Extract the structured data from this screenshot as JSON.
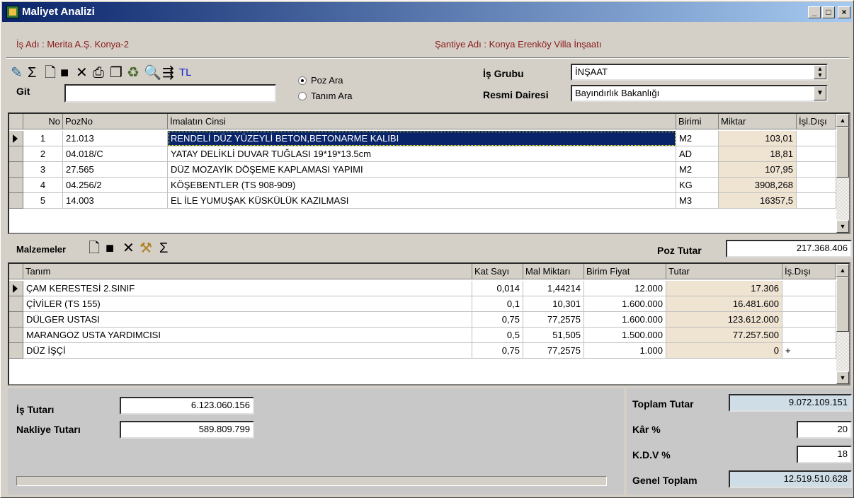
{
  "window": {
    "title": "Maliyet Analizi"
  },
  "info": {
    "is_adi": "İş Adı : Merita A.Ş. Konya-2",
    "santiye_adi": "Şantiye  Adı : Konya Erenköy Villa İnşaatı"
  },
  "toolbar": {
    "tl_label": "TL",
    "git_label": "Git",
    "git_value": ""
  },
  "search": {
    "poz_ara": "Poz Ara",
    "tanim_ara": "Tanım Ara",
    "selected": "Poz Ara"
  },
  "filters": {
    "is_grubu_label": "İş Grubu",
    "is_grubu_value": "İNŞAAT",
    "resmi_dairesi_label": "Resmi Dairesi",
    "resmi_dairesi_value": "Bayındırlık Bakanlığı"
  },
  "poz_table": {
    "headers": {
      "no": "No",
      "pozno": "PozNo",
      "imalat": "İmalatın Cinsi",
      "birimi": "Birimi",
      "miktar": "Miktar",
      "isl_disi": "İşl.Dışı"
    },
    "rows": [
      {
        "no": "1",
        "pozno": "21.013",
        "imalat": "RENDELİ DÜZ YÜZEYLİ BETON,BETONARME KALIBI",
        "birimi": "M2",
        "miktar": "103,01",
        "isl_disi": ""
      },
      {
        "no": "2",
        "pozno": "04.018/C",
        "imalat": "YATAY DELİKLİ DUVAR TUĞLASI 19*19*13.5cm",
        "birimi": "AD",
        "miktar": "18,81",
        "isl_disi": ""
      },
      {
        "no": "3",
        "pozno": "27.565",
        "imalat": "DÜZ MOZAYİK DÖŞEME KAPLAMASI YAPIMI",
        "birimi": "M2",
        "miktar": "107,95",
        "isl_disi": ""
      },
      {
        "no": "4",
        "pozno": "04.256/2",
        "imalat": "KÖŞEBENTLER (TS 908-909)",
        "birimi": "KG",
        "miktar": "3908,268",
        "isl_disi": ""
      },
      {
        "no": "5",
        "pozno": "14.003",
        "imalat": "EL İLE YUMUŞAK KÜSKÜLÜK KAZILMASI",
        "birimi": "M3",
        "miktar": "16357,5",
        "isl_disi": ""
      }
    ]
  },
  "malzemeler": {
    "label": "Malzemeler",
    "poz_tutar_label": "Poz Tutar",
    "poz_tutar_value": "217.368.406"
  },
  "mat_table": {
    "headers": {
      "tanim": "Tanım",
      "kat_sayi": "Kat Sayı",
      "mal_miktari": "Mal Miktarı",
      "birim_fiyat": "Birim Fiyat",
      "tutar": "Tutar",
      "is_disi": "İş.Dışı"
    },
    "rows": [
      {
        "tanim": "ÇAM KERESTESİ 2.SINIF",
        "kat_sayi": "0,014",
        "mal_miktari": "1,44214",
        "birim_fiyat": "12.000",
        "tutar": "17.306",
        "is_disi": ""
      },
      {
        "tanim": "ÇİVİLER (TS 155)",
        "kat_sayi": "0,1",
        "mal_miktari": "10,301",
        "birim_fiyat": "1.600.000",
        "tutar": "16.481.600",
        "is_disi": ""
      },
      {
        "tanim": "DÜLGER USTASI",
        "kat_sayi": "0,75",
        "mal_miktari": "77,2575",
        "birim_fiyat": "1.600.000",
        "tutar": "123.612.000",
        "is_disi": ""
      },
      {
        "tanim": "MARANGOZ USTA YARDIMCISI",
        "kat_sayi": "0,5",
        "mal_miktari": "51,505",
        "birim_fiyat": "1.500.000",
        "tutar": "77.257.500",
        "is_disi": ""
      },
      {
        "tanim": "DÜZ İŞÇİ",
        "kat_sayi": "0,75",
        "mal_miktari": "77,2575",
        "birim_fiyat": "1.000",
        "tutar": "0",
        "is_disi": "+"
      }
    ]
  },
  "totals": {
    "is_tutari_label": "İş Tutarı",
    "is_tutari_value": "6.123.060.156",
    "nakliye_label": "Nakliye Tutarı",
    "nakliye_value": "589.809.799",
    "toplam_label": "Toplam Tutar",
    "toplam_value": "9.072.109.151",
    "kar_label": "Kâr %",
    "kar_value": "20",
    "kdv_label": "K.D.V %",
    "kdv_value": "18",
    "genel_label": "Genel Toplam",
    "genel_value": "12.519.510.628"
  },
  "colors": {
    "title_start": "#0a246a",
    "title_end": "#a6caf0",
    "selection": "#0a246a",
    "info_text": "#8b1a1a",
    "qty_cell": "#efe3d2",
    "total_cell": "#cfdde6"
  },
  "progress": {
    "value": 0
  }
}
